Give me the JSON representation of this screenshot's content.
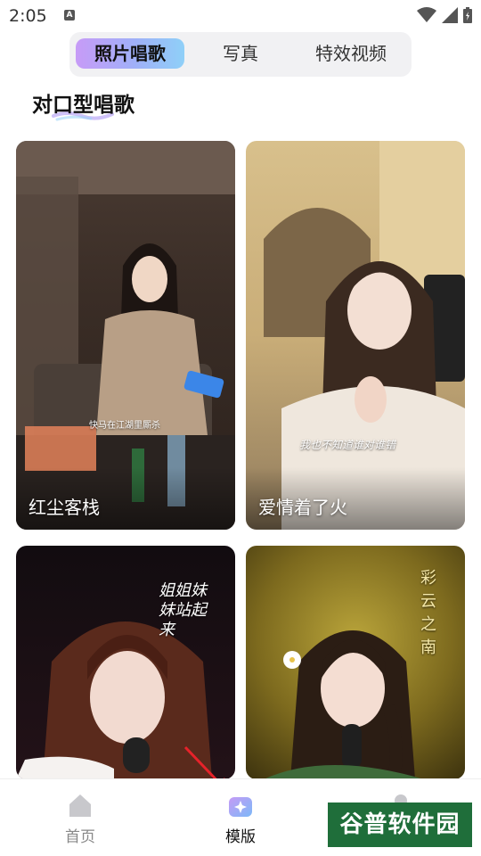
{
  "status": {
    "time": "2:05",
    "notif_icon": "A"
  },
  "tabs": [
    {
      "label": "照片唱歌",
      "active": true
    },
    {
      "label": "写真",
      "active": false
    },
    {
      "label": "特效视频",
      "active": false
    }
  ],
  "section": {
    "title": "对口型唱歌"
  },
  "cards": [
    {
      "label": "红尘客栈",
      "caption": "快马在江湖里厮杀"
    },
    {
      "label": "爱情着了火",
      "caption": "我也不知道谁对谁错"
    },
    {
      "label": "",
      "caption": "姐姐妹妹站起来"
    },
    {
      "label": "",
      "caption": "彩云之南"
    }
  ],
  "nav": [
    {
      "label": "首页",
      "active": false
    },
    {
      "label": "模版",
      "active": true
    },
    {
      "label": "",
      "active": false
    }
  ],
  "watermark": "谷普软件园",
  "colors": {
    "accent_gradient": [
      "#c79bf7",
      "#8fd0f8"
    ],
    "active_nav_icon": "#9f8af2"
  }
}
